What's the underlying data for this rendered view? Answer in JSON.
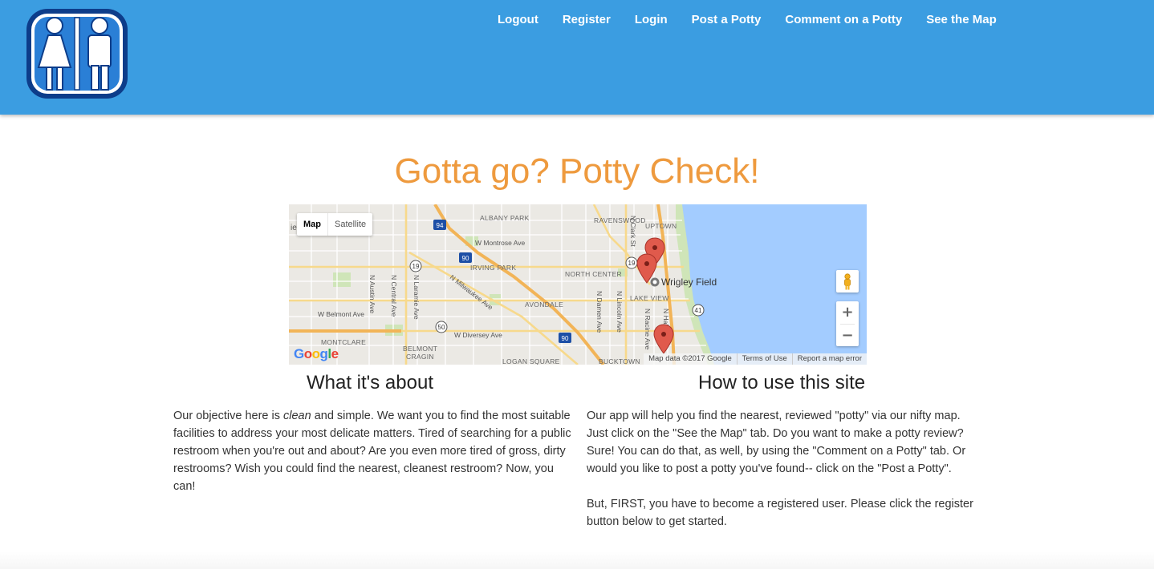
{
  "nav": {
    "items": [
      {
        "label": "Logout"
      },
      {
        "label": "Register"
      },
      {
        "label": "Login"
      },
      {
        "label": "Post a Potty"
      },
      {
        "label": "Comment on a Potty"
      },
      {
        "label": "See the Map"
      }
    ]
  },
  "colors": {
    "header": "#3b9de1",
    "title": "#ee9a3e",
    "water": "#a3ccff",
    "marker": "#e05a4c"
  },
  "main": {
    "title": "Gotta go? Potty Check!"
  },
  "map": {
    "type_buttons": {
      "map": "Map",
      "satellite": "Satellite"
    },
    "zoom_in": "+",
    "zoom_out": "−",
    "google": "Google",
    "attribution": {
      "data": "Map data ©2017 Google",
      "terms": "Terms of Use",
      "report": "Report a map error"
    },
    "labels": {
      "albany_park": "ALBANY PARK",
      "ravenswood": "RAVENSWOOD",
      "uptown": "UPTOWN",
      "montrose": "W Montrose Ave",
      "irving_park": "IRVING PARK",
      "north_center": "NORTH CENTER",
      "wrigley": "Wrigley Field",
      "lake_view": "LAKE VIEW",
      "avondale": "AVONDALE",
      "belmont": "W Belmont Ave",
      "diversey": "W Diversey Ave",
      "montclare": "MONTCLARE",
      "belmont_cragin_1": "BELMONT",
      "belmont_cragin_2": "CRAGIN",
      "logan_square": "LOGAN SQUARE",
      "bucktown": "BUCKTOWN",
      "milwaukee": "N Milwaukee Ave",
      "austin": "N Austin Ave",
      "central": "N Central Ave",
      "laramie": "N Laramie Ave",
      "lincoln": "N Lincoln Ave",
      "damen": "N Damen Ave",
      "racine": "N Racine Ave",
      "clark": "N Clark St",
      "halsted": "N Hal",
      "rt94": "94",
      "rt90a": "90",
      "rt90b": "90",
      "rt19a": "19",
      "rt19b": "19",
      "rt50": "50",
      "rt41": "41",
      "ie": "ie"
    },
    "markers": [
      "marker-1",
      "marker-2",
      "marker-3"
    ]
  },
  "about": {
    "title": "What it's about",
    "text_before": "Our objective here is ",
    "text_emph": "clean",
    "text_after": " and simple. We want you to find the most suitable facilities to address your most delicate matters. Tired of searching for a public restroom when you're out and about? Are you even more tired of gross, dirty restrooms? Wish you could find the nearest, cleanest restroom? Now, you can!"
  },
  "howto": {
    "title": "How to use this site",
    "paragraph_1": "Our app will help you find the nearest, reviewed \"potty\" via our nifty map. Just click on the \"See the Map\" tab. Do you want to make a potty review? Sure! You can do that, as well, by using the \"Comment on a Potty\" tab. Or would you like to post a potty you've found-- click on the \"Post a Potty\".",
    "paragraph_2": "But, FIRST, you have to become a registered user. Please click the register button below to get started."
  }
}
